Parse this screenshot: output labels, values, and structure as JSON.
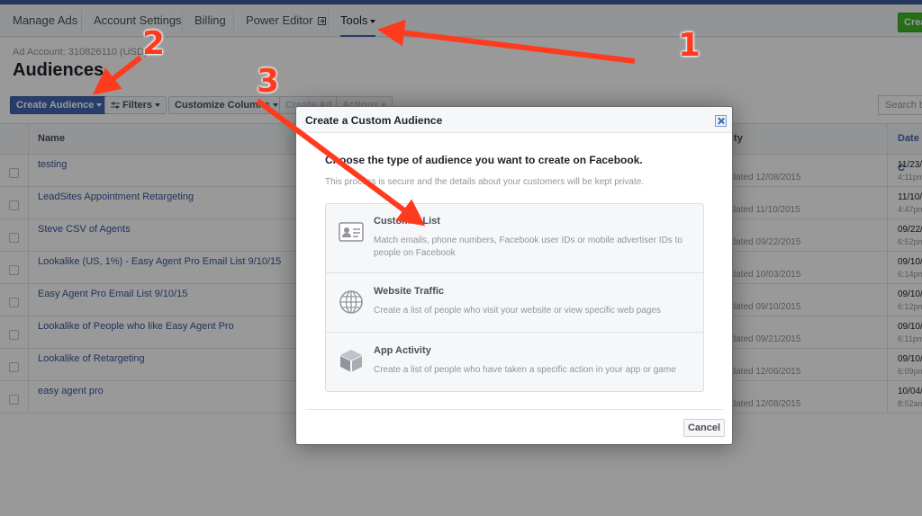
{
  "nav": {
    "items": [
      "Manage Ads",
      "Account Settings",
      "Billing",
      "Power Editor",
      "Tools"
    ],
    "create_label": "Crea"
  },
  "page": {
    "account": "Ad Account: 310826110 (USD)",
    "title": "Audiences"
  },
  "toolbar": {
    "create_audience": "Create Audience",
    "filters": "Filters",
    "customize_columns": "Customize Columns",
    "create_ad": "Create Ad",
    "actions": "Actions",
    "search_placeholder": "Search by"
  },
  "table": {
    "headers": {
      "name": "Name",
      "availability": "ity",
      "date": "Date C"
    },
    "rows": [
      {
        "name": "testing",
        "availability": "pdated 12/08/2015",
        "date": "11/23/",
        "time": "4:11pm"
      },
      {
        "name": "LeadSites Appointment Retargeting",
        "availability": "pdated 11/10/2015",
        "date": "11/10/",
        "time": "4:47pm"
      },
      {
        "name": "Steve CSV of Agents",
        "availability": "pdated 09/22/2015",
        "date": "09/22/",
        "time": "6:52pm"
      },
      {
        "name": "Lookalike (US, 1%) - Easy Agent Pro Email List 9/10/15",
        "availability": "pdated 10/03/2015",
        "date": "09/10/",
        "time": "6:14pm"
      },
      {
        "name": "Easy Agent Pro Email List 9/10/15",
        "availability": "pdated 09/10/2015",
        "date": "09/10/",
        "time": "6:12pm"
      },
      {
        "name": "Lookalike of People who like Easy Agent Pro",
        "availability": "pdated 09/21/2015",
        "date": "09/10/",
        "time": "6:11pm"
      },
      {
        "name": "Lookalike of Retargeting",
        "availability": "pdated 12/06/2015",
        "date": "09/10/",
        "time": "6:09pm"
      },
      {
        "name": "easy agent pro",
        "availability": "pdated 12/08/2015",
        "date": "10/04/",
        "time": "8:52am"
      }
    ]
  },
  "dialog": {
    "title": "Create a Custom Audience",
    "heading": "Choose the type of audience you want to create on Facebook.",
    "subtext": "This process is secure and the details about your customers will be kept private.",
    "options": [
      {
        "title": "Customer List",
        "description": "Match emails, phone numbers, Facebook user IDs or mobile advertiser IDs to people on Facebook",
        "icon": "contact-card-icon"
      },
      {
        "title": "Website Traffic",
        "description": "Create a list of people who visit your website or view specific web pages",
        "icon": "globe-icon"
      },
      {
        "title": "App Activity",
        "description": "Create a list of people who have taken a specific action in your app or game",
        "icon": "box-icon"
      }
    ],
    "cancel": "Cancel"
  },
  "annotations": {
    "labels": [
      "1",
      "2",
      "3"
    ],
    "color": "#ff3b1f"
  },
  "colors": {
    "brand": "#3b5998",
    "primary_button": "#4267b2",
    "create_green": "#42b72a"
  }
}
